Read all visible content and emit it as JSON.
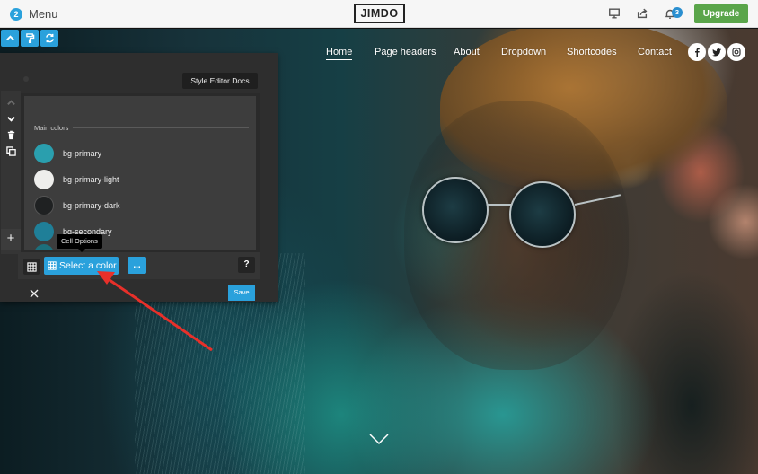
{
  "topbar": {
    "menu_badge": "2",
    "menu_label": "Menu",
    "logo": "JIMDO",
    "icons": [
      "desktop-preview-icon",
      "share-icon",
      "bell-icon"
    ],
    "notifications_count": "3",
    "upgrade_label": "Upgrade"
  },
  "edit_tools": [
    "collapse-icon",
    "paint-roller-icon",
    "refresh-icon"
  ],
  "site_nav": {
    "links": [
      {
        "label": "Home",
        "active": true
      },
      {
        "label": "Page headers",
        "active": false
      },
      {
        "label": "About",
        "active": false
      },
      {
        "label": "Dropdown",
        "active": false
      },
      {
        "label": "Shortcodes",
        "active": false
      },
      {
        "label": "Contact",
        "active": false
      }
    ],
    "social": [
      "facebook-icon",
      "twitter-icon",
      "instagram-icon"
    ],
    "social_glyphs": {
      "facebook": "f"
    }
  },
  "style_editor": {
    "docs_button": "Style Editor Docs",
    "rail_icons": [
      "move-up-icon",
      "move-down-icon",
      "delete-icon",
      "duplicate-icon"
    ],
    "add_label": "+",
    "section_label": "Main colors",
    "colors": [
      {
        "name": "bg-primary",
        "hex": "#2a9fae"
      },
      {
        "name": "bg-primary-light",
        "hex": "#eeeeec"
      },
      {
        "name": "bg-primary-dark",
        "hex": "#1f2122"
      },
      {
        "name": "bg-secondary",
        "hex": "#1f7f98"
      },
      {
        "name": "",
        "hex": "#1c6f7c"
      }
    ],
    "tooltip": "Cell Options",
    "select_color_label": "Select a color",
    "more_label": "...",
    "help_label": "?",
    "save_label": "Save"
  },
  "colors": {
    "accent": "#2aa1dc",
    "upgrade": "#5aa54a",
    "annotation_arrow": "#e8302a"
  }
}
